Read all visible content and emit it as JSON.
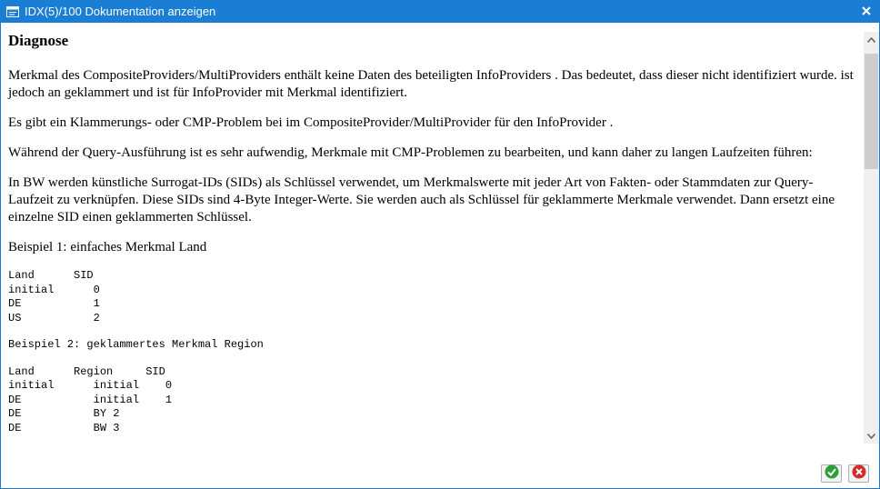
{
  "window": {
    "title": "IDX(5)/100 Dokumentation anzeigen"
  },
  "document": {
    "heading": "Diagnose",
    "paragraphs": [
      "Merkmal  des CompositeProviders/MultiProviders enthält keine Daten des beteiligten InfoProviders . Das bedeutet, dass dieser nicht identifiziert wurde.  ist jedoch an  geklammert und  ist für InfoProvider  mit Merkmal  identifiziert.",
      "Es gibt ein Klammerungs- oder CMP-Problem bei  im CompositeProvider/MultiProvider für den InfoProvider .",
      "Während der Query-Ausführung ist es sehr aufwendig, Merkmale mit CMP-Problemen zu bearbeiten, und kann daher zu langen Laufzeiten führen:",
      "In BW werden künstliche Surrogat-IDs (SIDs) als Schlüssel verwendet, um Merkmalswerte mit jeder Art von Fakten- oder Stammdaten zur Query-Laufzeit zu verknüpfen. Diese SIDs sind 4-Byte Integer-Werte. Sie werden auch als Schlüssel für geklammerte Merkmale verwendet. Dann ersetzt eine einzelne SID einen geklammerten Schlüssel.",
      "Beispiel 1: einfaches Merkmal Land"
    ],
    "example1_table": "Land      SID\ninitial      0\nDE           1\nUS           2",
    "example2_title": "Beispiel 2: geklammertes Merkmal Region",
    "example2_table": "Land      Region     SID\ninitial      initial    0\nDE           initial    1\nDE           BY 2\nDE           BW 3"
  },
  "buttons": {
    "ok": "check-icon",
    "cancel": "cancel-icon"
  },
  "colors": {
    "titlebar": "#1a7fd4",
    "ok_green": "#2e9e3a",
    "cancel_red": "#d42a2a"
  }
}
